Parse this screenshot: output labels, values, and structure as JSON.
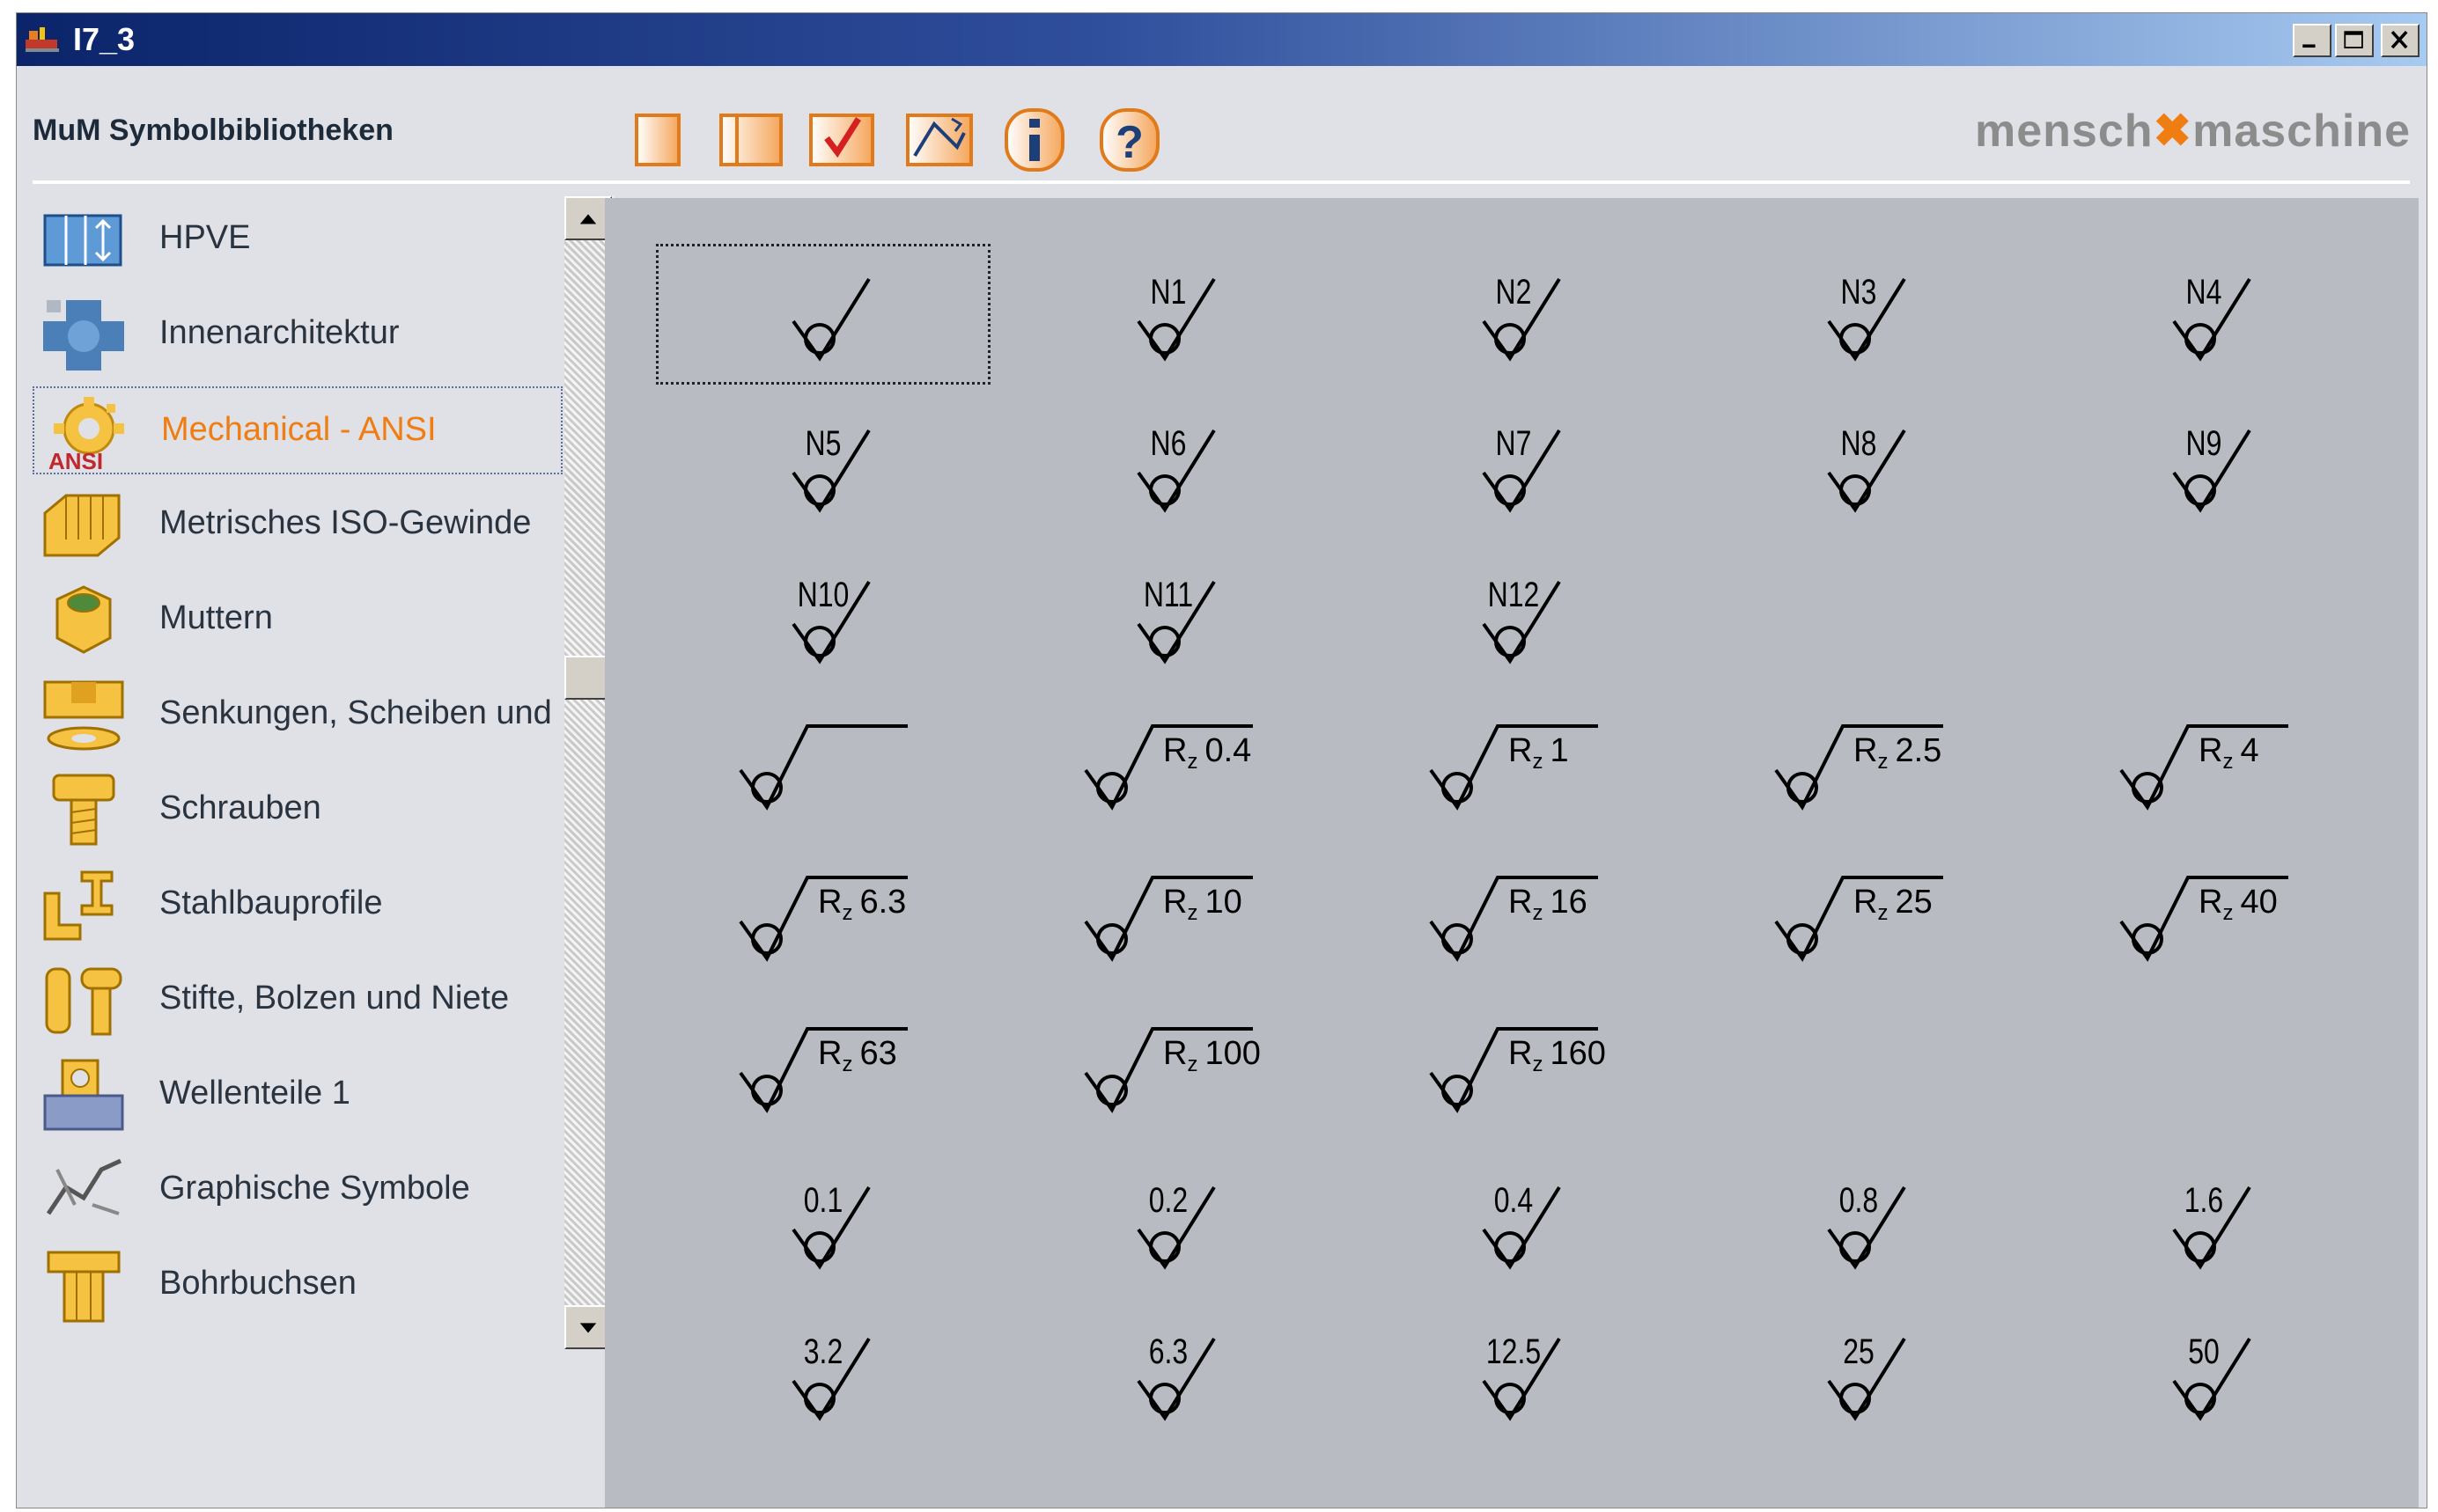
{
  "window": {
    "title": "I7_3"
  },
  "header": {
    "title": "MuM Symbolbibliotheken",
    "brand_left": "mensch",
    "brand_right": "maschine",
    "toolbar": [
      {
        "icon": "blank-page-icon"
      },
      {
        "icon": "panel-page-icon"
      },
      {
        "icon": "checkmark-icon"
      },
      {
        "icon": "graphic-page-icon"
      },
      {
        "icon": "info-icon",
        "label": "i"
      },
      {
        "icon": "help-icon",
        "label": "?"
      }
    ]
  },
  "libraries": [
    {
      "label": "HPVE",
      "icon": "hpve-icon"
    },
    {
      "label": "Innenarchitektur",
      "icon": "interior-icon"
    },
    {
      "label": "Mechanical - ANSI",
      "icon": "ansi-gear-icon",
      "badge": "ANSI",
      "selected": true
    },
    {
      "label": "Metrisches ISO-Gewinde",
      "icon": "thread-icon"
    },
    {
      "label": "Muttern",
      "icon": "nut-icon"
    },
    {
      "label": "Senkungen, Scheiben und Du",
      "icon": "washer-icon"
    },
    {
      "label": "Schrauben",
      "icon": "screw-icon"
    },
    {
      "label": "Stahlbauprofile",
      "icon": "steel-profile-icon"
    },
    {
      "label": "Stifte, Bolzen und Niete",
      "icon": "pin-icon"
    },
    {
      "label": "Wellenteile 1",
      "icon": "shaft-icon"
    },
    {
      "label": "Graphische Symbole",
      "icon": "graphic-symbol-icon"
    },
    {
      "label": "Bohrbuchsen",
      "icon": "bushing-icon"
    }
  ],
  "symbols": [
    {
      "type": "v",
      "label": ""
    },
    {
      "type": "v",
      "label": "N1"
    },
    {
      "type": "v",
      "label": "N2"
    },
    {
      "type": "v",
      "label": "N3"
    },
    {
      "type": "v",
      "label": "N4"
    },
    {
      "type": "v",
      "label": "N5"
    },
    {
      "type": "v",
      "label": "N6"
    },
    {
      "type": "v",
      "label": "N7"
    },
    {
      "type": "v",
      "label": "N8"
    },
    {
      "type": "v",
      "label": "N9"
    },
    {
      "type": "v",
      "label": "N10"
    },
    {
      "type": "v",
      "label": "N11"
    },
    {
      "type": "v",
      "label": "N12"
    },
    {
      "type": "none"
    },
    {
      "type": "none"
    },
    {
      "type": "rz",
      "prefix": "",
      "value": ""
    },
    {
      "type": "rz",
      "prefix": "Rz",
      "value": "0.4"
    },
    {
      "type": "rz",
      "prefix": "Rz",
      "value": "1"
    },
    {
      "type": "rz",
      "prefix": "Rz",
      "value": "2.5"
    },
    {
      "type": "rz",
      "prefix": "Rz",
      "value": "4"
    },
    {
      "type": "rz",
      "prefix": "Rz",
      "value": "6.3"
    },
    {
      "type": "rz",
      "prefix": "Rz",
      "value": "10"
    },
    {
      "type": "rz",
      "prefix": "Rz",
      "value": "16"
    },
    {
      "type": "rz",
      "prefix": "Rz",
      "value": "25"
    },
    {
      "type": "rz",
      "prefix": "Rz",
      "value": "40"
    },
    {
      "type": "rz",
      "prefix": "Rz",
      "value": "63"
    },
    {
      "type": "rz",
      "prefix": "Rz",
      "value": "100"
    },
    {
      "type": "rz",
      "prefix": "Rz",
      "value": "160"
    },
    {
      "type": "none"
    },
    {
      "type": "none"
    },
    {
      "type": "v",
      "label": "0.1"
    },
    {
      "type": "v",
      "label": "0.2"
    },
    {
      "type": "v",
      "label": "0.4"
    },
    {
      "type": "v",
      "label": "0.8"
    },
    {
      "type": "v",
      "label": "1.6"
    },
    {
      "type": "v",
      "label": "3.2"
    },
    {
      "type": "v",
      "label": "6.3"
    },
    {
      "type": "v",
      "label": "12.5"
    },
    {
      "type": "v",
      "label": "25"
    },
    {
      "type": "v",
      "label": "50"
    }
  ],
  "colors": {
    "accent": "#f07d12",
    "panel_bg": "#b8bcc2",
    "window_bg": "#dfe1e6"
  }
}
